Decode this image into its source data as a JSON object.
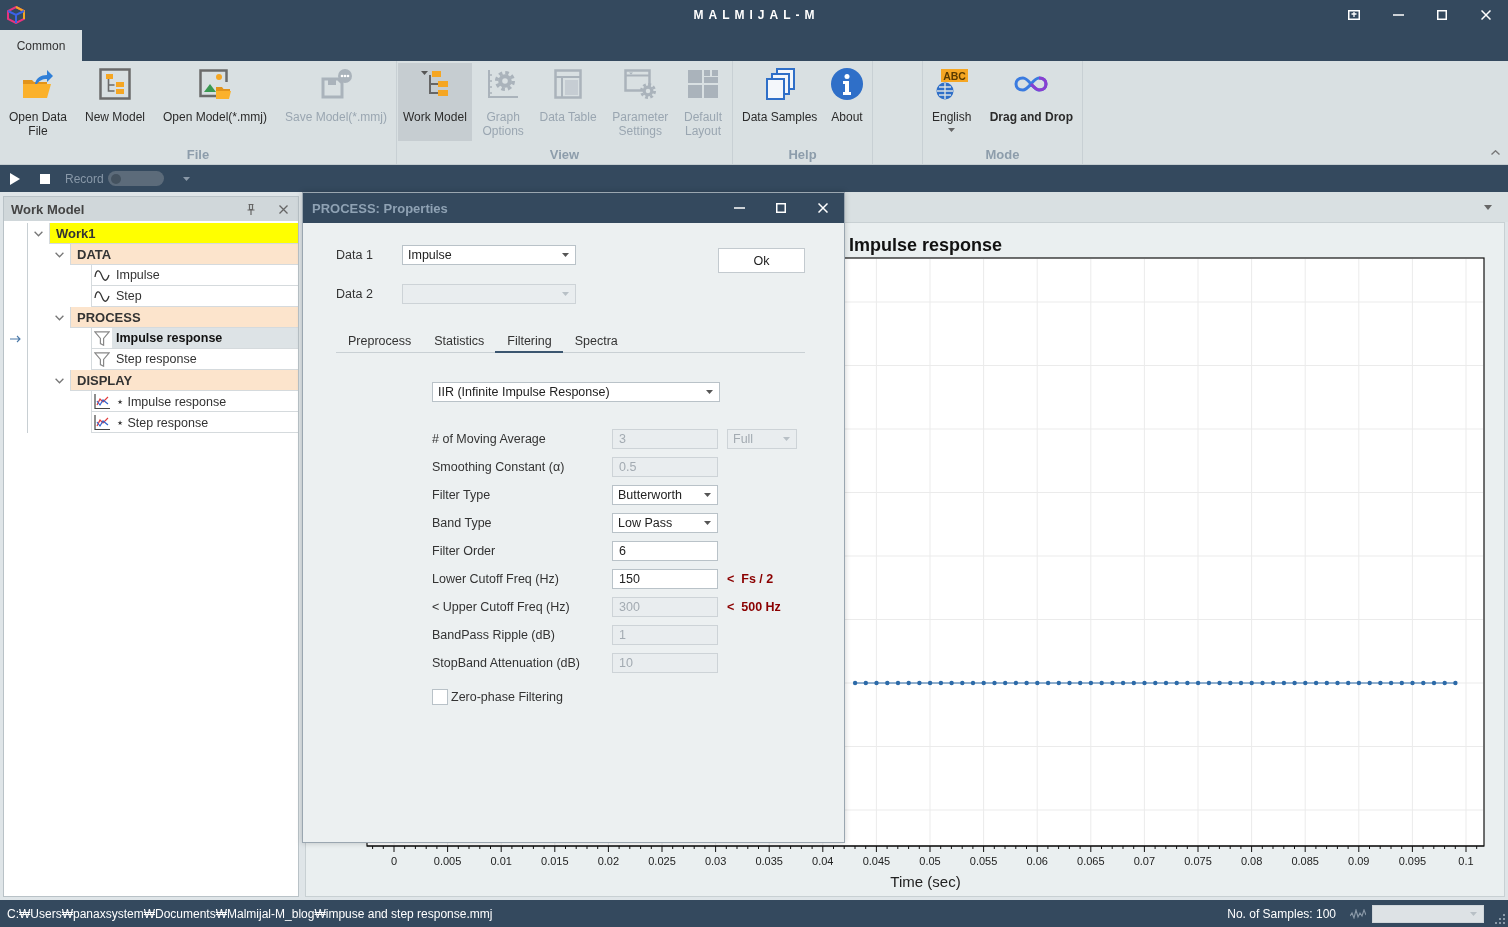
{
  "window": {
    "title": "MALMIJAL-M"
  },
  "ribbon": {
    "tabs": [
      {
        "label": "Common",
        "selected": true
      }
    ],
    "groups": [
      {
        "label": "File",
        "buttons": [
          {
            "label": "Open Data\nFile",
            "selected": false,
            "disabled": false
          },
          {
            "label": "New Model",
            "selected": false,
            "disabled": false
          },
          {
            "label": "Open Model(*.mmj)",
            "selected": false,
            "disabled": false
          },
          {
            "label": "Save Model(*.mmj)",
            "selected": false,
            "disabled": true
          }
        ]
      },
      {
        "label": "View",
        "buttons": [
          {
            "label": "Work Model",
            "selected": true,
            "disabled": false
          },
          {
            "label": "Graph\nOptions",
            "selected": false,
            "disabled": true
          },
          {
            "label": "Data Table",
            "selected": false,
            "disabled": true
          },
          {
            "label": "Parameter\nSettings",
            "selected": false,
            "disabled": true
          },
          {
            "label": "Default\nLayout",
            "selected": false,
            "disabled": true
          }
        ]
      },
      {
        "label": "Help",
        "buttons": [
          {
            "label": "Data Samples",
            "selected": false,
            "disabled": false
          },
          {
            "label": "About",
            "selected": false,
            "disabled": false
          }
        ]
      },
      {
        "label": "Mode",
        "buttons": [
          {
            "label": "English",
            "badge": "ABC",
            "dropdown": true,
            "selected": false,
            "disabled": false,
            "on": false
          },
          {
            "label": "Drag and Drop",
            "selected": false,
            "disabled": false,
            "on": true
          }
        ]
      }
    ]
  },
  "toolbar": {
    "record": {
      "label": "Record",
      "on": false
    }
  },
  "work_model": {
    "title": "Work Model",
    "tree": [
      {
        "label": "Work1",
        "kind": "model",
        "expanded": true,
        "selected": false,
        "children": [
          {
            "label": "DATA",
            "kind": "group",
            "expanded": true,
            "selected": false,
            "children": [
              {
                "label": "Impulse",
                "kind": "data",
                "selected": false
              },
              {
                "label": "Step",
                "kind": "data",
                "selected": false
              }
            ]
          },
          {
            "label": "PROCESS",
            "kind": "group",
            "expanded": true,
            "selected": false,
            "children": [
              {
                "label": "Impulse response",
                "kind": "process",
                "selected": true
              },
              {
                "label": "Step response",
                "kind": "process",
                "selected": false
              }
            ]
          },
          {
            "label": "DISPLAY",
            "kind": "group",
            "expanded": true,
            "selected": false,
            "children": [
              {
                "label": "⋆ Impulse response",
                "kind": "display",
                "selected": false
              },
              {
                "label": "⋆ Step response",
                "kind": "display",
                "selected": false
              }
            ]
          }
        ]
      }
    ]
  },
  "properties_dialog": {
    "title": "PROCESS: Properties",
    "inputs": [
      {
        "label": "Data 1",
        "value": "Impulse",
        "disabled": false
      },
      {
        "label": "Data 2",
        "disabled": true
      }
    ],
    "ok_button": "Ok",
    "tabs": [
      {
        "label": "Preprocess",
        "selected": false
      },
      {
        "label": "Statistics",
        "selected": false
      },
      {
        "label": "Filtering",
        "selected": true
      },
      {
        "label": "Spectra",
        "selected": false
      }
    ],
    "filter_method": {
      "value": "IIR (Infinite Impulse Response)"
    },
    "fields": [
      {
        "label": "# of Moving Average",
        "kind": "text",
        "value": "3",
        "disabled": true,
        "option": {
          "value": "Full",
          "disabled": true
        }
      },
      {
        "label": "Smoothing Constant (α)",
        "kind": "text",
        "value": "0.5",
        "disabled": true
      },
      {
        "label": "Filter Type",
        "kind": "combo",
        "value": "Butterworth",
        "disabled": false
      },
      {
        "label": "Band Type",
        "kind": "combo",
        "value": "Low Pass",
        "disabled": false
      },
      {
        "label": "Filter Order",
        "kind": "text",
        "value": "6",
        "disabled": false
      },
      {
        "label": "Lower Cutoff Freq (Hz)",
        "kind": "text",
        "value": "150",
        "disabled": false,
        "note": "<  Fs / 2"
      },
      {
        "label": "< Upper Cutoff Freq (Hz)",
        "kind": "text",
        "value": "300",
        "disabled": true,
        "note": "<  500 Hz"
      },
      {
        "label": "BandPass Ripple (dB)",
        "kind": "text",
        "value": "1",
        "disabled": true
      },
      {
        "label": "StopBand Attenuation (dB)",
        "kind": "text",
        "value": "10",
        "disabled": true
      }
    ],
    "zero_phase": {
      "label": "Zero-phase Filtering",
      "checked": false
    }
  },
  "document": {
    "plot": {
      "title": "Impulse response",
      "x_tick_labels": [
        "0",
        "0.005",
        "0.01",
        "0.015",
        "0.02",
        "0.025",
        "0.03",
        "0.035",
        "0.04",
        "0.045",
        "0.05",
        "0.055",
        "0.06",
        "0.065",
        "0.07",
        "0.075",
        "0.08",
        "0.085",
        "0.09",
        "0.095",
        "0.1"
      ],
      "x_axis_title": "Time (sec)"
    }
  },
  "status_bar": {
    "path": "C:₩Users₩panaxsystem₩Documents₩Malmijal-M_blog₩impuse and step response.mmj",
    "samples": "No. of Samples: 100",
    "selector": {
      "disabled": true
    }
  }
}
